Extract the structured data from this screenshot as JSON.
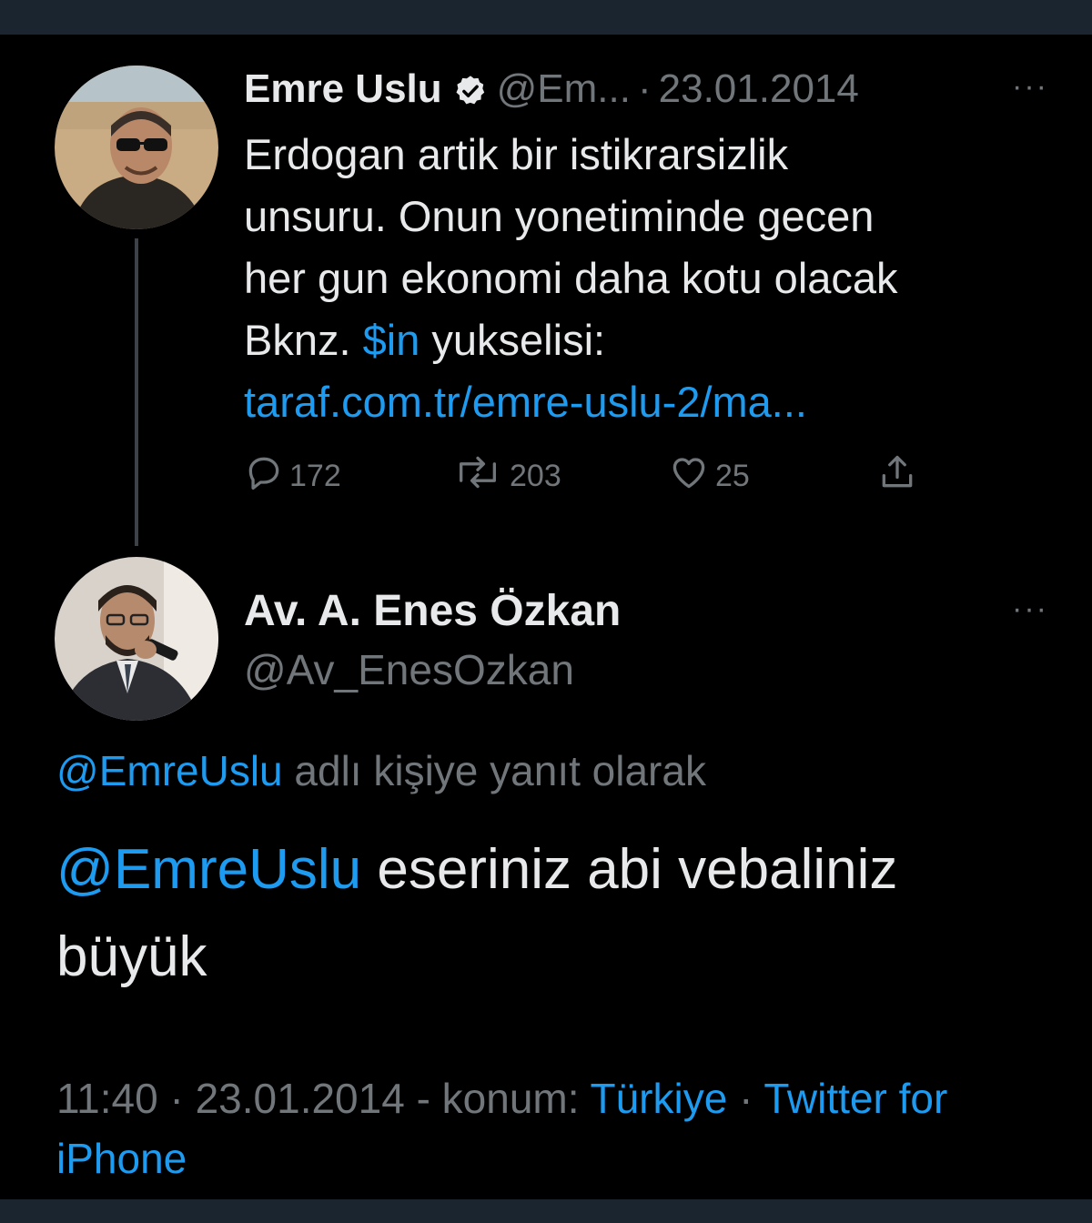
{
  "tweet1": {
    "name": "Emre Uslu",
    "handle": "@Em...",
    "separator": "·",
    "date": "23.01.2014",
    "more": "···",
    "body": {
      "line1": "Erdogan artik bir istikrarsizlik",
      "line2": "unsuru. Onun yonetiminde gecen",
      "line3": "her gun ekonomi daha kotu olacak",
      "line4_prefix": "Bknz. ",
      "cashtag": "$in",
      "line4_suffix": " yukselisi:",
      "link": "taraf.com.tr/emre-uslu-2/ma..."
    },
    "actions": {
      "replies": "172",
      "retweets": "203",
      "likes": "25"
    }
  },
  "tweet2": {
    "name": "Av. A. Enes Özkan",
    "handle": "@Av_EnesOzkan",
    "more": "···",
    "reply_mention": "@EmreUslu",
    "reply_text": " adlı kişiye yanıt olarak",
    "body_mention": "@EmreUslu",
    "body_text_line1": " eseriniz abi vebaliniz",
    "body_text_line2": "büyük",
    "meta": {
      "time_date": "11:40 · 23.01.2014 - konum: ",
      "location": "Türkiye",
      "sep": " · ",
      "client": "Twitter for iPhone"
    }
  },
  "colors": {
    "background": "#000000",
    "text": "#e7e9ea",
    "secondary": "#71767b",
    "accent": "#1d9bf0",
    "frame": "#1b2530"
  },
  "icons": [
    "verified-badge-icon",
    "reply-icon",
    "retweet-icon",
    "like-icon",
    "share-icon",
    "more-icon"
  ]
}
